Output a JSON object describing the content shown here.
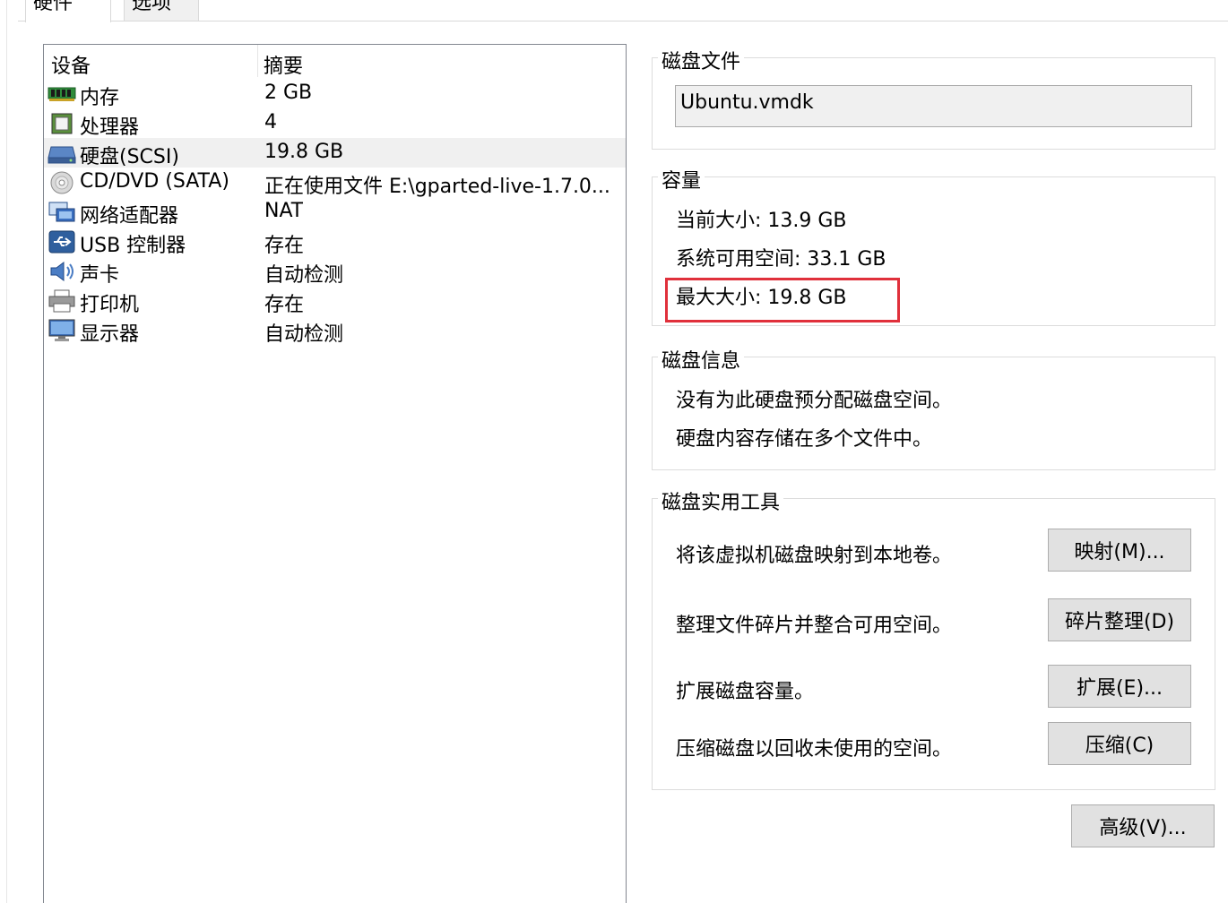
{
  "tabs": [
    {
      "label": "硬件"
    },
    {
      "label": "选项"
    }
  ],
  "device_list": {
    "columns": [
      "设备",
      "摘要"
    ],
    "rows": [
      {
        "name": "内存",
        "summary": "2 GB",
        "icon": "memory-icon"
      },
      {
        "name": "处理器",
        "summary": "4",
        "icon": "processor-icon"
      },
      {
        "name": "硬盘(SCSI)",
        "summary": "19.8 GB",
        "icon": "hard-disk-icon",
        "selected": true
      },
      {
        "name": "CD/DVD (SATA)",
        "summary": "正在使用文件 E:\\gparted-live-1.7.0...",
        "icon": "cd-dvd-icon"
      },
      {
        "name": "网络适配器",
        "summary": "NAT",
        "icon": "network-adapter-icon"
      },
      {
        "name": "USB 控制器",
        "summary": "存在",
        "icon": "usb-icon"
      },
      {
        "name": "声卡",
        "summary": "自动检测",
        "icon": "sound-card-icon"
      },
      {
        "name": "打印机",
        "summary": "存在",
        "icon": "printer-icon"
      },
      {
        "name": "显示器",
        "summary": "自动检测",
        "icon": "display-icon"
      }
    ]
  },
  "disk_file": {
    "title": "磁盘文件",
    "value": "Ubuntu.vmdk"
  },
  "capacity": {
    "title": "容量",
    "current_size": "当前大小: 13.9 GB",
    "system_free": "系统可用空间: 33.1 GB",
    "max_size": "最大大小: 19.8 GB",
    "highlight_color": "#e0303b"
  },
  "disk_info": {
    "title": "磁盘信息",
    "line1": "没有为此硬盘预分配磁盘空间。",
    "line2": "硬盘内容存储在多个文件中。"
  },
  "disk_utilities": {
    "title": "磁盘实用工具",
    "map_text": "将该虚拟机磁盘映射到本地卷。",
    "map_button": "映射(M)...",
    "defrag_text": "整理文件碎片并整合可用空间。",
    "defrag_button": "碎片整理(D)",
    "expand_text": "扩展磁盘容量。",
    "expand_button": "扩展(E)...",
    "compact_text": "压缩磁盘以回收未使用的空间。",
    "compact_button": "压缩(C)"
  },
  "advanced_button": "高级(V)..."
}
